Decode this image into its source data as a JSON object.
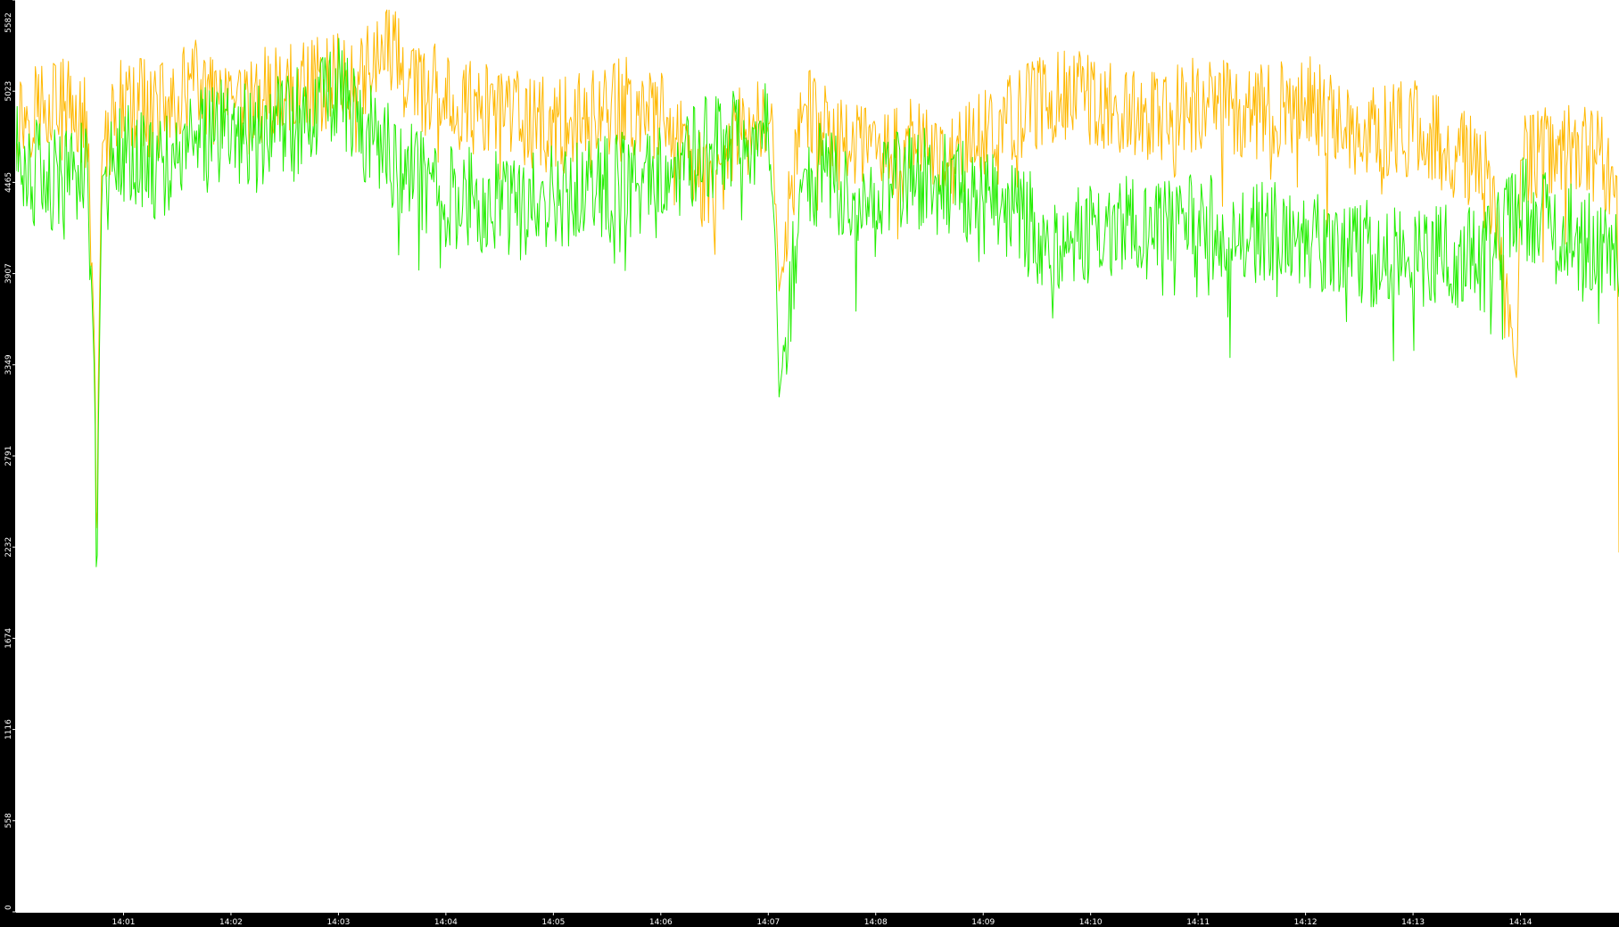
{
  "chart_data": {
    "type": "line",
    "title": "",
    "xlabel": "",
    "ylabel": "",
    "background_color": "#000000",
    "plot_background_color": "#ffffff",
    "axis_color": "#ffffff",
    "grid": false,
    "legend": "none",
    "ylim": [
      0,
      5582
    ],
    "y_ticks": [
      "0",
      "558",
      "1116",
      "1674",
      "2232",
      "2791",
      "3349",
      "3907",
      "4465",
      "5023",
      "5582"
    ],
    "x_range": [
      "14:00:00",
      "14:14:55"
    ],
    "x_ticks": [
      {
        "time": "14:01",
        "label": "14:01"
      },
      {
        "time": "14:02",
        "label": "14:02"
      },
      {
        "time": "14:03",
        "label": "14:03"
      },
      {
        "time": "14:04",
        "label": "14:04"
      },
      {
        "time": "14:05",
        "label": "14:05"
      },
      {
        "time": "14:06",
        "label": "14:06"
      },
      {
        "time": "14:07",
        "label": "14:07"
      },
      {
        "time": "14:08",
        "label": "14:08"
      },
      {
        "time": "14:09",
        "label": "14:09"
      },
      {
        "time": "14:10",
        "label": "14:10"
      },
      {
        "time": "14:11",
        "label": "14:11"
      },
      {
        "time": "14:12",
        "label": "14:12"
      },
      {
        "time": "14:13",
        "label": "14:13"
      },
      {
        "time": "14:14",
        "label": "14:14"
      }
    ],
    "series": [
      {
        "color": "#ffb800",
        "x": [
          "14:00:00",
          "14:00:20",
          "14:00:40",
          "14:00:44",
          "14:00:45",
          "14:00:46",
          "14:00:48",
          "14:01:00",
          "14:01:20",
          "14:01:40",
          "14:02:00",
          "14:02:20",
          "14:02:40",
          "14:03:00",
          "14:03:20",
          "14:03:30",
          "14:03:40",
          "14:04:00",
          "14:04:20",
          "14:04:40",
          "14:05:00",
          "14:05:20",
          "14:05:40",
          "14:06:00",
          "14:06:20",
          "14:06:30",
          "14:06:40",
          "14:07:00",
          "14:07:04",
          "14:07:06",
          "14:07:20",
          "14:07:40",
          "14:08:00",
          "14:08:20",
          "14:08:40",
          "14:09:00",
          "14:09:20",
          "14:09:40",
          "14:10:00",
          "14:10:20",
          "14:10:40",
          "14:11:00",
          "14:11:20",
          "14:11:40",
          "14:12:00",
          "14:12:20",
          "14:12:40",
          "14:13:00",
          "14:13:20",
          "14:13:40",
          "14:13:58",
          "14:14:00",
          "14:14:20",
          "14:14:40",
          "14:14:54",
          "14:14:55"
        ],
        "y": [
          4850,
          5000,
          4800,
          3400,
          2000,
          3300,
          4700,
          4950,
          4900,
          5050,
          4850,
          5000,
          5050,
          5100,
          5200,
          5300,
          5050,
          5000,
          4900,
          4850,
          4800,
          4850,
          4950,
          4850,
          4600,
          4250,
          4750,
          4900,
          4400,
          3800,
          4950,
          4700,
          4650,
          4700,
          4600,
          4750,
          4900,
          5000,
          5000,
          4850,
          4850,
          4950,
          4900,
          4900,
          4950,
          4850,
          4750,
          4800,
          4650,
          4600,
          3250,
          4600,
          4700,
          4650,
          4500,
          2200
        ]
      },
      {
        "color": "#22ee00",
        "x": [
          "14:00:00",
          "14:00:20",
          "14:00:40",
          "14:00:44",
          "14:00:45",
          "14:00:46",
          "14:00:48",
          "14:01:00",
          "14:01:20",
          "14:01:40",
          "14:02:00",
          "14:02:20",
          "14:02:40",
          "14:03:00",
          "14:03:20",
          "14:03:40",
          "14:04:00",
          "14:04:20",
          "14:04:40",
          "14:05:00",
          "14:05:20",
          "14:05:40",
          "14:06:00",
          "14:06:20",
          "14:06:40",
          "14:07:00",
          "14:07:04",
          "14:07:06",
          "14:07:20",
          "14:07:40",
          "14:08:00",
          "14:08:20",
          "14:08:40",
          "14:09:00",
          "14:09:20",
          "14:09:40",
          "14:10:00",
          "14:10:20",
          "14:10:40",
          "14:11:00",
          "14:11:20",
          "14:11:40",
          "14:12:00",
          "14:12:20",
          "14:12:40",
          "14:13:00",
          "14:13:20",
          "14:13:40",
          "14:14:00",
          "14:14:20",
          "14:14:40",
          "14:14:55"
        ],
        "y": [
          4650,
          4450,
          4600,
          3200,
          1750,
          3000,
          4500,
          4650,
          4550,
          4700,
          4800,
          4750,
          4900,
          5050,
          4700,
          4550,
          4400,
          4350,
          4300,
          4400,
          4400,
          4450,
          4500,
          4650,
          4700,
          4800,
          4100,
          3150,
          4550,
          4450,
          4400,
          4500,
          4450,
          4350,
          4250,
          4100,
          4150,
          4200,
          4150,
          4200,
          4150,
          4150,
          4100,
          4100,
          4000,
          4050,
          4000,
          4000,
          4350,
          4150,
          4100,
          4050
        ]
      }
    ]
  }
}
